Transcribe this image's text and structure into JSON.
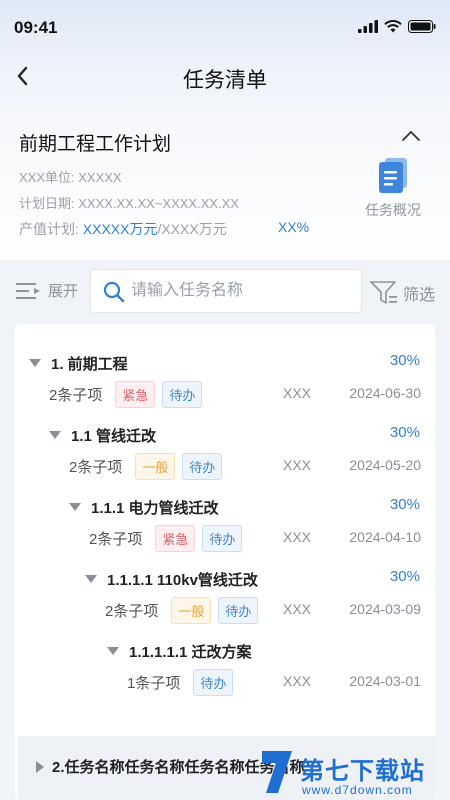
{
  "status_bar": {
    "time": "09:41"
  },
  "nav": {
    "title": "任务清单"
  },
  "plan": {
    "title": "前期工程工作计划",
    "unit": "XXX单位: XXXXX",
    "date": "计划日期: XXXX.XX.XX~XXXX.XX.XX",
    "output_label": "产值计划: ",
    "output_value": "XXXXX万元",
    "output_total": "/XXXX万元",
    "output_pct": "XX%",
    "overview_label": "任务概况"
  },
  "toolbar": {
    "expand_label": "展开",
    "search_placeholder": "请输入任务名称",
    "filter_label": "筛选"
  },
  "tasks": [
    {
      "name": "1.  前期工程",
      "pct": "30%",
      "count": "2条子项",
      "tags": [
        "紧急",
        "待办"
      ],
      "owner": "XXX",
      "date": "2024-06-30"
    },
    {
      "name": "1.1  管线迁改",
      "pct": "30%",
      "count": "2条子项",
      "tags": [
        "一般",
        "待办"
      ],
      "owner": "XXX",
      "date": "2024-05-20"
    },
    {
      "name": "1.1.1  电力管线迁改",
      "pct": "30%",
      "count": "2条子项",
      "tags": [
        "紧急",
        "待办"
      ],
      "owner": "XXX",
      "date": "2024-04-10"
    },
    {
      "name": "1.1.1.1  110kv管线迁改",
      "pct": "30%",
      "count": "2条子项",
      "tags": [
        "一般",
        "待办"
      ],
      "owner": "XXX",
      "date": "2024-03-09"
    },
    {
      "name": "1.1.1.1.1  迁改方案",
      "pct": "",
      "count": "1条子项",
      "tags": [
        "待办"
      ],
      "owner": "XXX",
      "date": "2024-03-01"
    },
    {
      "name": "2.任务名称任务名称任务名称任务名称"
    }
  ],
  "watermark": {
    "brand": "第七下载站",
    "url": "www.d7down.com"
  },
  "colors": {
    "accent": "#2e7fd6",
    "urgent": "#e0606a",
    "normal": "#e8a23b",
    "todo": "#3f86d0"
  }
}
